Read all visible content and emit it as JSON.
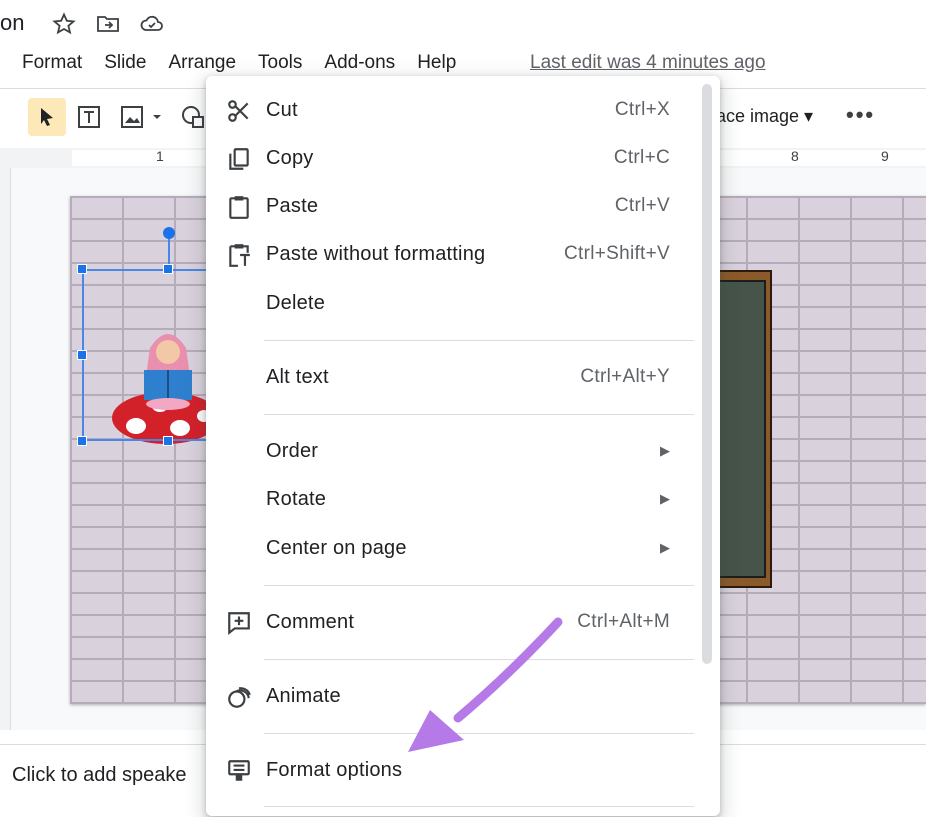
{
  "title": {
    "fragment": "on"
  },
  "menubar": {
    "items": [
      "Format",
      "Slide",
      "Arrange",
      "Tools",
      "Add-ons",
      "Help"
    ],
    "last_edit": "Last edit was 4 minutes ago"
  },
  "toolbar": {
    "replace_image": "ace image ▾"
  },
  "ruler": {
    "labels": [
      "1",
      "8",
      "9"
    ]
  },
  "notes": {
    "placeholder": "Click to add speake"
  },
  "context_menu": {
    "items": [
      {
        "label": "Cut",
        "shortcut": "Ctrl+X",
        "icon": "scissors-icon"
      },
      {
        "label": "Copy",
        "shortcut": "Ctrl+C",
        "icon": "copy-icon"
      },
      {
        "label": "Paste",
        "shortcut": "Ctrl+V",
        "icon": "clipboard-icon"
      },
      {
        "label": "Paste without formatting",
        "shortcut": "Ctrl+Shift+V",
        "icon": "clipboard-text-icon"
      },
      {
        "label": "Delete",
        "shortcut": ""
      },
      {
        "label": "Alt text",
        "shortcut": "Ctrl+Alt+Y"
      },
      {
        "label": "Order",
        "submenu": true
      },
      {
        "label": "Rotate",
        "submenu": true
      },
      {
        "label": "Center on page",
        "submenu": true
      },
      {
        "label": "Comment",
        "shortcut": "Ctrl+Alt+M",
        "icon": "comment-add-icon"
      },
      {
        "label": "Animate",
        "icon": "animate-icon"
      },
      {
        "label": "Format options",
        "icon": "format-options-icon"
      }
    ]
  },
  "colors": {
    "accent": "#1a73e8",
    "selection_fill": "#fde9b8",
    "annotation_arrow": "#b57ae8"
  }
}
